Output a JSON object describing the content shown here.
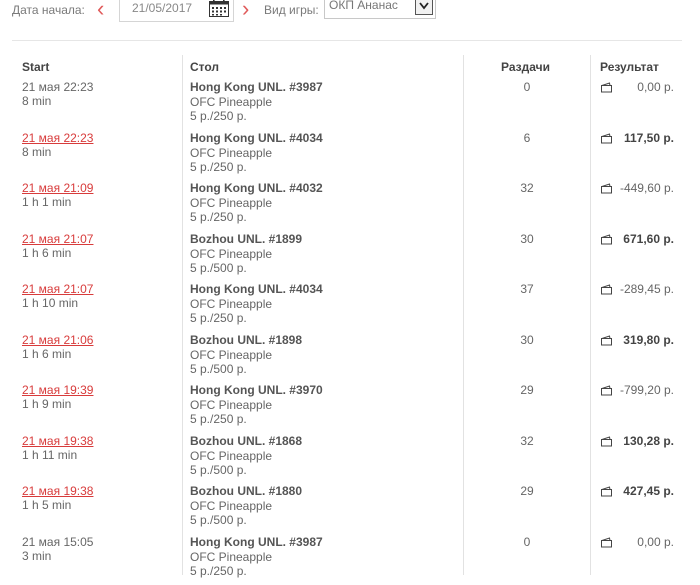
{
  "filters": {
    "date_label": "Дата начала:",
    "date_value": "21/05/2017",
    "game_label": "Вид игры:",
    "game_value": "ОКП Ананас"
  },
  "table": {
    "headers": {
      "start": "Start",
      "table": "Стол",
      "hands": "Раздачи",
      "result": "Результат"
    },
    "rows": [
      {
        "time": "21 мая 22:23",
        "linked": false,
        "duration": "8 min",
        "table": "Hong Kong UNL. #3987",
        "game": "OFC Pineapple",
        "stakes": "5 р./250 р.",
        "hands": "0",
        "result": "0,00 р.",
        "bold": false
      },
      {
        "time": "21 мая 22:23",
        "linked": true,
        "duration": "8 min",
        "table": "Hong Kong UNL. #4034",
        "game": "OFC Pineapple",
        "stakes": "5 р./250 р.",
        "hands": "6",
        "result": "117,50 р.",
        "bold": true
      },
      {
        "time": "21 мая 21:09",
        "linked": true,
        "duration": "1 h 1 min",
        "table": "Hong Kong UNL. #4032",
        "game": "OFC Pineapple",
        "stakes": "5 р./250 р.",
        "hands": "32",
        "result": "-449,60 р.",
        "bold": false
      },
      {
        "time": "21 мая 21:07",
        "linked": true,
        "duration": "1 h 6 min",
        "table": "Bozhou UNL. #1899",
        "game": "OFC Pineapple",
        "stakes": "5 р./500 р.",
        "hands": "30",
        "result": "671,60 р.",
        "bold": true
      },
      {
        "time": "21 мая 21:07",
        "linked": true,
        "duration": "1 h 10 min",
        "table": "Hong Kong UNL. #4034",
        "game": "OFC Pineapple",
        "stakes": "5 р./250 р.",
        "hands": "37",
        "result": "-289,45 р.",
        "bold": false
      },
      {
        "time": "21 мая 21:06",
        "linked": true,
        "duration": "1 h 6 min",
        "table": "Bozhou UNL. #1898",
        "game": "OFC Pineapple",
        "stakes": "5 р./500 р.",
        "hands": "30",
        "result": "319,80 р.",
        "bold": true
      },
      {
        "time": "21 мая 19:39",
        "linked": true,
        "duration": "1 h 9 min",
        "table": "Hong Kong UNL. #3970",
        "game": "OFC Pineapple",
        "stakes": "5 р./250 р.",
        "hands": "29",
        "result": "-799,20 р.",
        "bold": false
      },
      {
        "time": "21 мая 19:38",
        "linked": true,
        "duration": "1 h 11 min",
        "table": "Bozhou UNL. #1868",
        "game": "OFC Pineapple",
        "stakes": "5 р./500 р.",
        "hands": "32",
        "result": "130,28 р.",
        "bold": true
      },
      {
        "time": "21 мая 19:38",
        "linked": true,
        "duration": "1 h 5 min",
        "table": "Bozhou UNL. #1880",
        "game": "OFC Pineapple",
        "stakes": "5 р./500 р.",
        "hands": "29",
        "result": "427,45 р.",
        "bold": true
      },
      {
        "time": "21 мая 15:05",
        "linked": false,
        "duration": "3 min",
        "table": "Hong Kong UNL. #3987",
        "game": "OFC Pineapple",
        "stakes": "5 р./250 р.",
        "hands": "0",
        "result": "0,00 р.",
        "bold": false
      }
    ]
  },
  "icons": {
    "prev": "chevron-left-icon",
    "next": "chevron-right-icon",
    "calendar": "calendar-icon",
    "dropdown": "chevron-down-icon",
    "wallet": "wallet-icon"
  },
  "colors": {
    "link": "#d83b3b",
    "arrow": "#e05a5a",
    "divider": "#e2e2e2"
  }
}
